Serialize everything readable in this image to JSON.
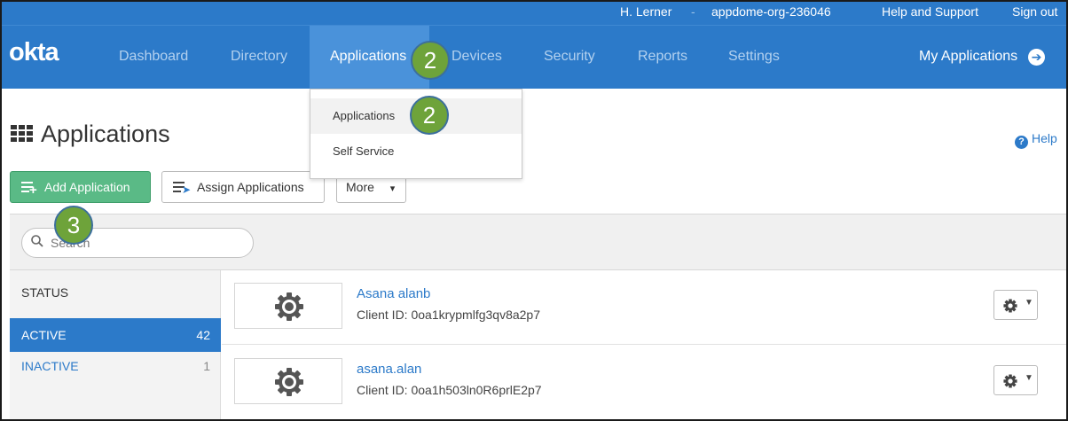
{
  "util_bar": {
    "user": "H. Lerner",
    "separator": "-",
    "org": "appdome-org-236046",
    "help_support": "Help and Support",
    "sign_out": "Sign out"
  },
  "nav": {
    "logo": "okta",
    "items": [
      "Dashboard",
      "Directory",
      "Applications",
      "Devices",
      "Security",
      "Reports",
      "Settings"
    ],
    "active": "Applications",
    "my_applications": "My Applications"
  },
  "dropdown": {
    "items": [
      "Applications",
      "Self Service"
    ]
  },
  "badges": {
    "nav": "2",
    "dropdown": "2",
    "add_app": "3"
  },
  "page": {
    "title": "Applications",
    "help": "Help"
  },
  "toolbar": {
    "add_application": "Add Application",
    "assign_applications": "Assign Applications",
    "more": "More",
    "more_caret": "▾"
  },
  "search": {
    "placeholder": "Search"
  },
  "sidebar": {
    "header": "STATUS",
    "items": [
      {
        "label": "ACTIVE",
        "count": "42"
      },
      {
        "label": "INACTIVE",
        "count": "1"
      }
    ]
  },
  "apps": [
    {
      "name": "Asana alanb",
      "client_id": "Client ID: 0oa1krypmlfg3qv8a2p7"
    },
    {
      "name": "asana.alan",
      "client_id": "Client ID: 0oa1h503ln0R6prlE2p7"
    }
  ],
  "colors": {
    "nav_blue": "#2c7ac9",
    "nav_active": "#4a92da",
    "add_green": "#5aba86",
    "badge_green": "#6ea33a"
  },
  "icons": {
    "grid": "grid-icon",
    "add": "add-list-icon",
    "assign": "assign-list-icon",
    "search": "search-icon",
    "app_logo": "gear-icon",
    "row_menu": "gear-icon",
    "my_apps": "arrow-circle-right-icon",
    "help": "question-circle-icon"
  }
}
